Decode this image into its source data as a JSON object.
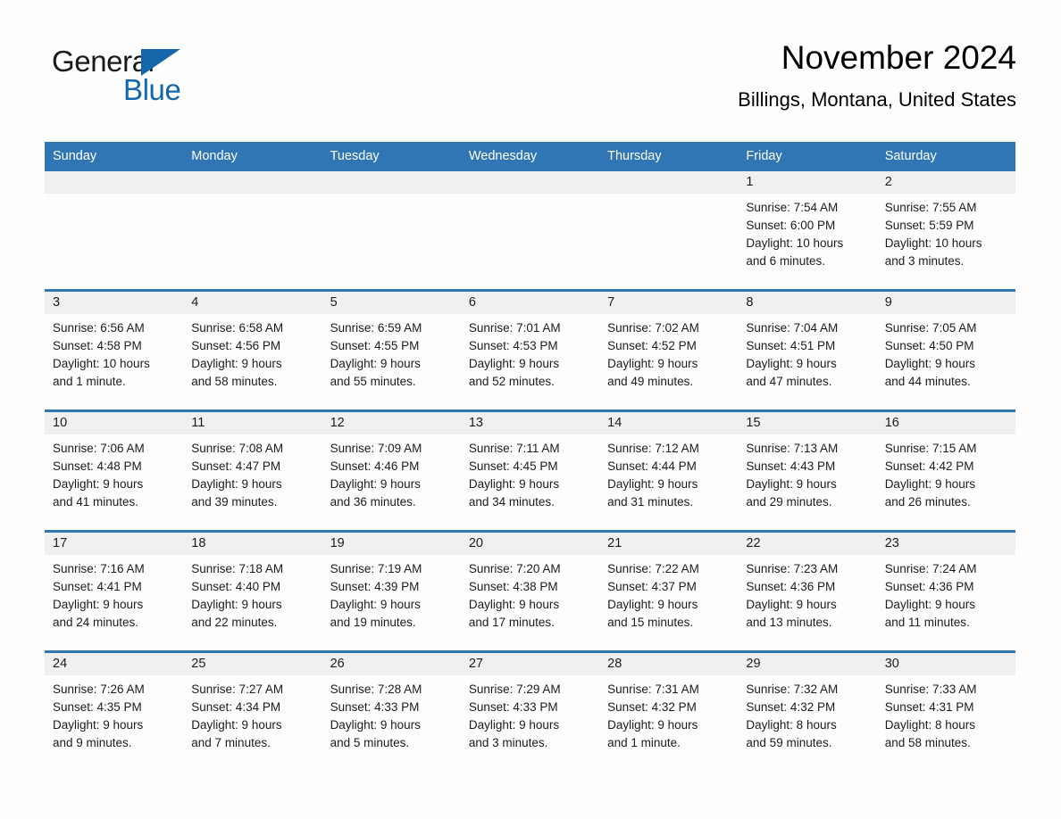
{
  "brand": {
    "word_one": "General",
    "word_two": "Blue",
    "triangle_icon": "right-triangle-icon",
    "accent_color": "#1567ab"
  },
  "header": {
    "title": "November 2024",
    "subtitle": "Billings, Montana, United States"
  },
  "theme": {
    "header_blue": "#3076b4",
    "day_band_gray": "#f0f0f0",
    "page_background": "#fdfdfd"
  },
  "weekday_headers": [
    "Sunday",
    "Monday",
    "Tuesday",
    "Wednesday",
    "Thursday",
    "Friday",
    "Saturday"
  ],
  "labels": {
    "sunrise_prefix": "Sunrise:",
    "sunset_prefix": "Sunset:",
    "daylight_prefix": "Daylight:"
  },
  "weeks": [
    [
      {
        "day": "",
        "blank": true
      },
      {
        "day": "",
        "blank": true
      },
      {
        "day": "",
        "blank": true
      },
      {
        "day": "",
        "blank": true
      },
      {
        "day": "",
        "blank": true
      },
      {
        "day": "1",
        "sunrise": "Sunrise: 7:54 AM",
        "sunset": "Sunset: 6:00 PM",
        "daylight_line1": "Daylight: 10 hours",
        "daylight_line2": "and 6 minutes."
      },
      {
        "day": "2",
        "sunrise": "Sunrise: 7:55 AM",
        "sunset": "Sunset: 5:59 PM",
        "daylight_line1": "Daylight: 10 hours",
        "daylight_line2": "and 3 minutes."
      }
    ],
    [
      {
        "day": "3",
        "sunrise": "Sunrise: 6:56 AM",
        "sunset": "Sunset: 4:58 PM",
        "daylight_line1": "Daylight: 10 hours",
        "daylight_line2": "and 1 minute."
      },
      {
        "day": "4",
        "sunrise": "Sunrise: 6:58 AM",
        "sunset": "Sunset: 4:56 PM",
        "daylight_line1": "Daylight: 9 hours",
        "daylight_line2": "and 58 minutes."
      },
      {
        "day": "5",
        "sunrise": "Sunrise: 6:59 AM",
        "sunset": "Sunset: 4:55 PM",
        "daylight_line1": "Daylight: 9 hours",
        "daylight_line2": "and 55 minutes."
      },
      {
        "day": "6",
        "sunrise": "Sunrise: 7:01 AM",
        "sunset": "Sunset: 4:53 PM",
        "daylight_line1": "Daylight: 9 hours",
        "daylight_line2": "and 52 minutes."
      },
      {
        "day": "7",
        "sunrise": "Sunrise: 7:02 AM",
        "sunset": "Sunset: 4:52 PM",
        "daylight_line1": "Daylight: 9 hours",
        "daylight_line2": "and 49 minutes."
      },
      {
        "day": "8",
        "sunrise": "Sunrise: 7:04 AM",
        "sunset": "Sunset: 4:51 PM",
        "daylight_line1": "Daylight: 9 hours",
        "daylight_line2": "and 47 minutes."
      },
      {
        "day": "9",
        "sunrise": "Sunrise: 7:05 AM",
        "sunset": "Sunset: 4:50 PM",
        "daylight_line1": "Daylight: 9 hours",
        "daylight_line2": "and 44 minutes."
      }
    ],
    [
      {
        "day": "10",
        "sunrise": "Sunrise: 7:06 AM",
        "sunset": "Sunset: 4:48 PM",
        "daylight_line1": "Daylight: 9 hours",
        "daylight_line2": "and 41 minutes."
      },
      {
        "day": "11",
        "sunrise": "Sunrise: 7:08 AM",
        "sunset": "Sunset: 4:47 PM",
        "daylight_line1": "Daylight: 9 hours",
        "daylight_line2": "and 39 minutes."
      },
      {
        "day": "12",
        "sunrise": "Sunrise: 7:09 AM",
        "sunset": "Sunset: 4:46 PM",
        "daylight_line1": "Daylight: 9 hours",
        "daylight_line2": "and 36 minutes."
      },
      {
        "day": "13",
        "sunrise": "Sunrise: 7:11 AM",
        "sunset": "Sunset: 4:45 PM",
        "daylight_line1": "Daylight: 9 hours",
        "daylight_line2": "and 34 minutes."
      },
      {
        "day": "14",
        "sunrise": "Sunrise: 7:12 AM",
        "sunset": "Sunset: 4:44 PM",
        "daylight_line1": "Daylight: 9 hours",
        "daylight_line2": "and 31 minutes."
      },
      {
        "day": "15",
        "sunrise": "Sunrise: 7:13 AM",
        "sunset": "Sunset: 4:43 PM",
        "daylight_line1": "Daylight: 9 hours",
        "daylight_line2": "and 29 minutes."
      },
      {
        "day": "16",
        "sunrise": "Sunrise: 7:15 AM",
        "sunset": "Sunset: 4:42 PM",
        "daylight_line1": "Daylight: 9 hours",
        "daylight_line2": "and 26 minutes."
      }
    ],
    [
      {
        "day": "17",
        "sunrise": "Sunrise: 7:16 AM",
        "sunset": "Sunset: 4:41 PM",
        "daylight_line1": "Daylight: 9 hours",
        "daylight_line2": "and 24 minutes."
      },
      {
        "day": "18",
        "sunrise": "Sunrise: 7:18 AM",
        "sunset": "Sunset: 4:40 PM",
        "daylight_line1": "Daylight: 9 hours",
        "daylight_line2": "and 22 minutes."
      },
      {
        "day": "19",
        "sunrise": "Sunrise: 7:19 AM",
        "sunset": "Sunset: 4:39 PM",
        "daylight_line1": "Daylight: 9 hours",
        "daylight_line2": "and 19 minutes."
      },
      {
        "day": "20",
        "sunrise": "Sunrise: 7:20 AM",
        "sunset": "Sunset: 4:38 PM",
        "daylight_line1": "Daylight: 9 hours",
        "daylight_line2": "and 17 minutes."
      },
      {
        "day": "21",
        "sunrise": "Sunrise: 7:22 AM",
        "sunset": "Sunset: 4:37 PM",
        "daylight_line1": "Daylight: 9 hours",
        "daylight_line2": "and 15 minutes."
      },
      {
        "day": "22",
        "sunrise": "Sunrise: 7:23 AM",
        "sunset": "Sunset: 4:36 PM",
        "daylight_line1": "Daylight: 9 hours",
        "daylight_line2": "and 13 minutes."
      },
      {
        "day": "23",
        "sunrise": "Sunrise: 7:24 AM",
        "sunset": "Sunset: 4:36 PM",
        "daylight_line1": "Daylight: 9 hours",
        "daylight_line2": "and 11 minutes."
      }
    ],
    [
      {
        "day": "24",
        "sunrise": "Sunrise: 7:26 AM",
        "sunset": "Sunset: 4:35 PM",
        "daylight_line1": "Daylight: 9 hours",
        "daylight_line2": "and 9 minutes."
      },
      {
        "day": "25",
        "sunrise": "Sunrise: 7:27 AM",
        "sunset": "Sunset: 4:34 PM",
        "daylight_line1": "Daylight: 9 hours",
        "daylight_line2": "and 7 minutes."
      },
      {
        "day": "26",
        "sunrise": "Sunrise: 7:28 AM",
        "sunset": "Sunset: 4:33 PM",
        "daylight_line1": "Daylight: 9 hours",
        "daylight_line2": "and 5 minutes."
      },
      {
        "day": "27",
        "sunrise": "Sunrise: 7:29 AM",
        "sunset": "Sunset: 4:33 PM",
        "daylight_line1": "Daylight: 9 hours",
        "daylight_line2": "and 3 minutes."
      },
      {
        "day": "28",
        "sunrise": "Sunrise: 7:31 AM",
        "sunset": "Sunset: 4:32 PM",
        "daylight_line1": "Daylight: 9 hours",
        "daylight_line2": "and 1 minute."
      },
      {
        "day": "29",
        "sunrise": "Sunrise: 7:32 AM",
        "sunset": "Sunset: 4:32 PM",
        "daylight_line1": "Daylight: 8 hours",
        "daylight_line2": "and 59 minutes."
      },
      {
        "day": "30",
        "sunrise": "Sunrise: 7:33 AM",
        "sunset": "Sunset: 4:31 PM",
        "daylight_line1": "Daylight: 8 hours",
        "daylight_line2": "and 58 minutes."
      }
    ]
  ]
}
